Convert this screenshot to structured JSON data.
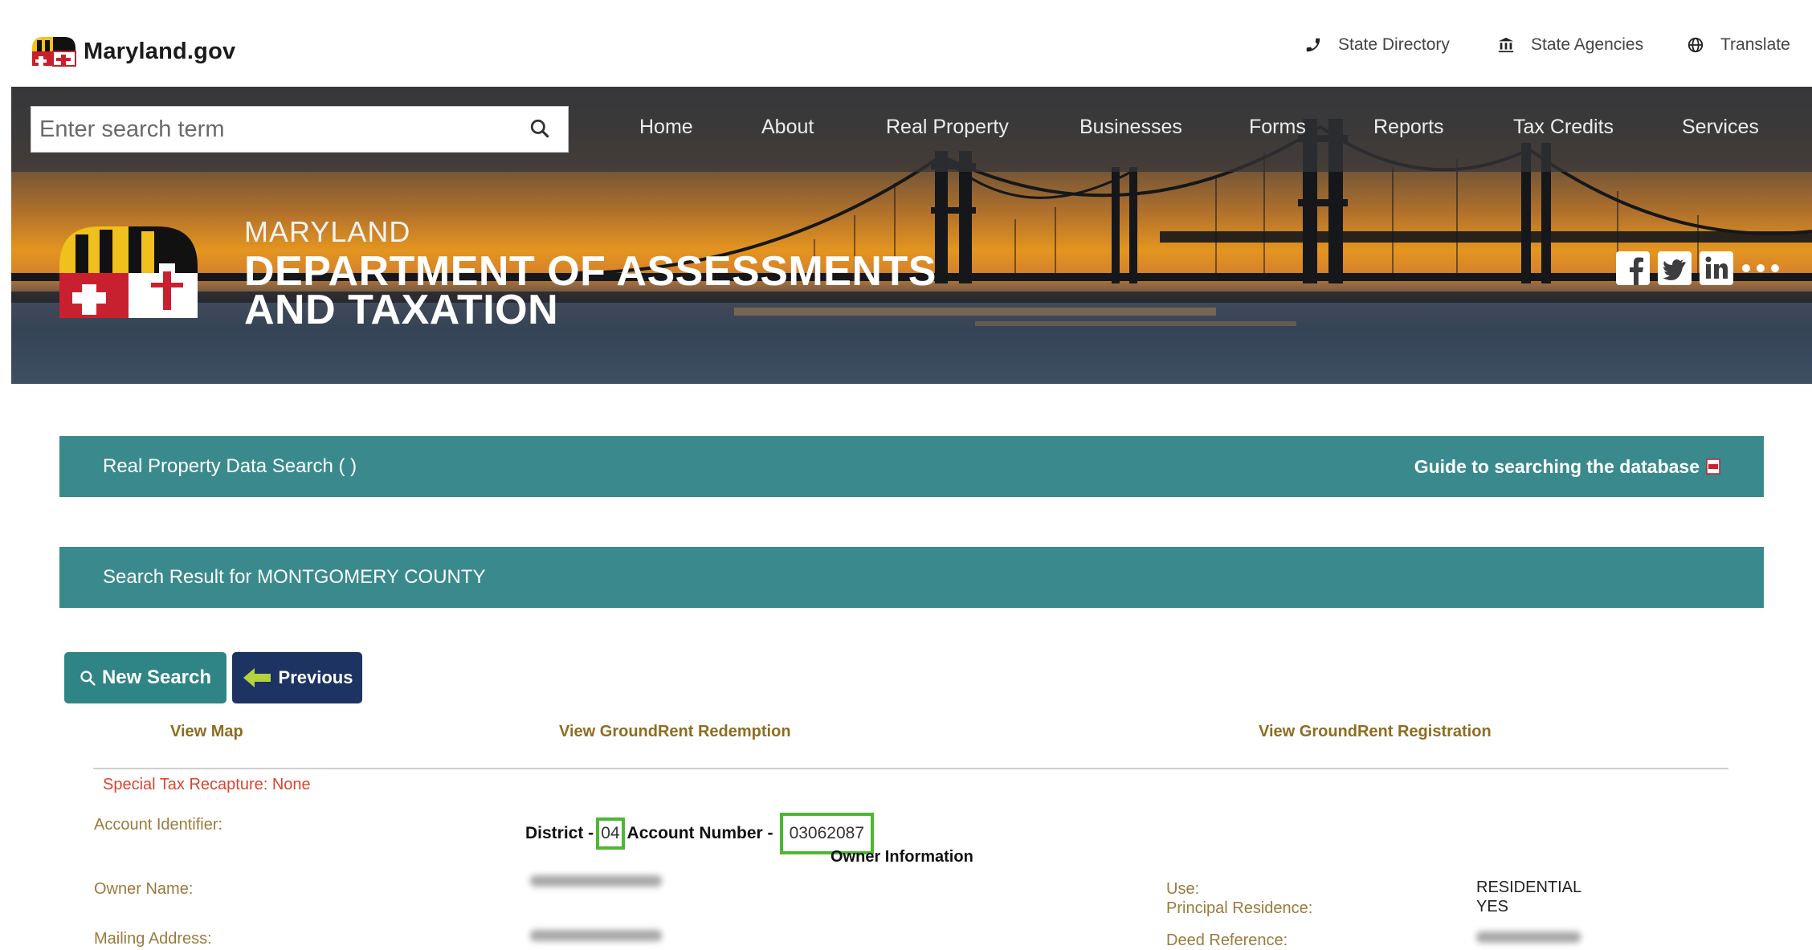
{
  "site": {
    "brand": "Maryland.gov"
  },
  "utility_nav": [
    {
      "label": "State Directory",
      "icon": "phone-icon"
    },
    {
      "label": "State Agencies",
      "icon": "building-icon"
    },
    {
      "label": "Translate",
      "icon": "globe-icon"
    }
  ],
  "search": {
    "placeholder": "Enter search term",
    "value": ""
  },
  "main_nav": [
    {
      "label": "Home"
    },
    {
      "label": "About"
    },
    {
      "label": "Real Property"
    },
    {
      "label": "Businesses"
    },
    {
      "label": "Forms"
    },
    {
      "label": "Reports"
    },
    {
      "label": "Tax Credits"
    },
    {
      "label": "Services"
    }
  ],
  "header": {
    "eyebrow": "MARYLAND",
    "title_line1": "DEPARTMENT OF ASSESSMENTS",
    "title_line2": "AND TAXATION"
  },
  "social": [
    "facebook-icon",
    "twitter-icon",
    "linkedin-icon",
    "more-icon"
  ],
  "section": {
    "title": "Real Property Data Search ( )",
    "guide_link": "Guide to searching the database"
  },
  "results": {
    "title": "Search Result for MONTGOMERY COUNTY"
  },
  "buttons": {
    "new_search": "New Search",
    "previous": "Previous"
  },
  "links": {
    "view_map": "View Map",
    "groundrent_redemption": "View GroundRent Redemption",
    "groundrent_registration": "View GroundRent Registration"
  },
  "record": {
    "special_tax": "Special Tax Recapture: None",
    "account_identifier_label": "Account Identifier:",
    "district_label": "District -",
    "district_value": "04",
    "account_number_label": "Account Number -",
    "account_number_value": "03062087",
    "owner_info_heading": "Owner Information",
    "owner_name_label": "Owner Name:",
    "mailing_address_label": "Mailing Address:",
    "use_label": "Use:",
    "use_value": "RESIDENTIAL",
    "principal_residence_label": "Principal Residence:",
    "principal_residence_value": "YES",
    "deed_reference_label": "Deed Reference:"
  },
  "colors": {
    "teal": "#3a8a8d",
    "navy_button": "#1d3462",
    "gold_link": "#8d6d1f",
    "label_gold": "#9a7b3e",
    "recapture_red": "#d9452f",
    "highlight_green": "#4cb832"
  }
}
